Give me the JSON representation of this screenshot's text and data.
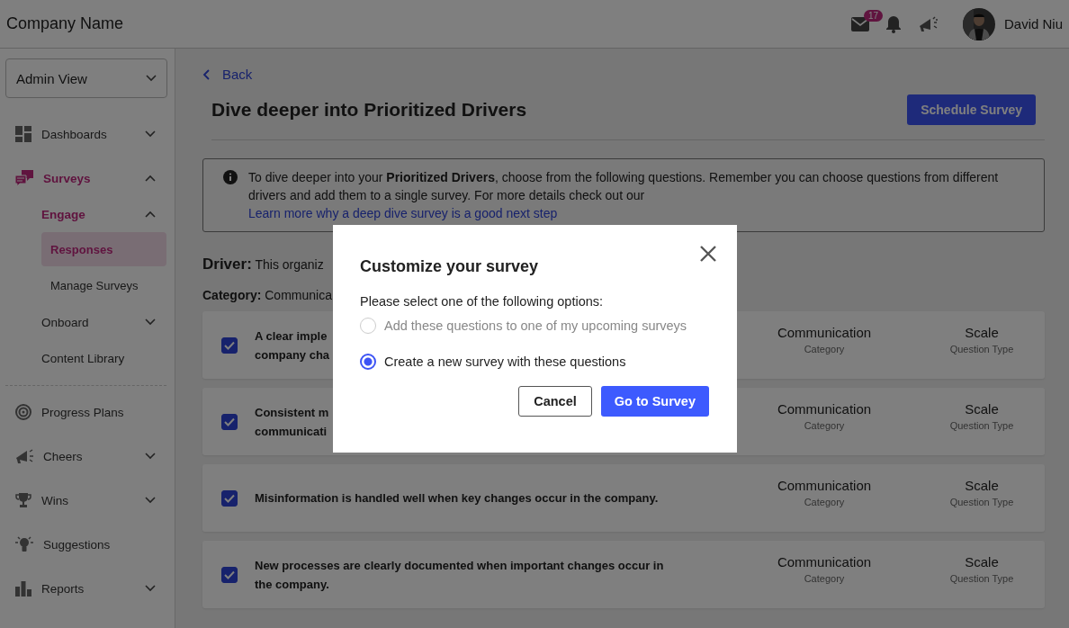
{
  "header": {
    "company": "Company Name",
    "mail_badge": "17",
    "user_name": "David Niu"
  },
  "sidebar": {
    "view_select": "Admin View",
    "groups": [
      [
        {
          "label": "Dashboards",
          "kind": "dashboards",
          "active": false,
          "expanded": false
        },
        {
          "label": "Surveys",
          "kind": "surveys",
          "active": true,
          "expanded": true,
          "children": [
            {
              "label": "Engage",
              "active": true,
              "expanded": true,
              "children": [
                {
                  "label": "Responses",
                  "selected": true
                },
                {
                  "label": "Manage Surveys",
                  "selected": false
                }
              ]
            },
            {
              "label": "Onboard",
              "active": false,
              "expanded": false
            },
            {
              "label": "Content Library",
              "active": false
            }
          ]
        }
      ],
      [
        {
          "label": "Progress Plans",
          "kind": "target",
          "active": false
        },
        {
          "label": "Cheers",
          "kind": "megaphone",
          "active": false,
          "expanded": false
        },
        {
          "label": "Wins",
          "kind": "trophy",
          "active": false,
          "expanded": false
        },
        {
          "label": "Suggestions",
          "kind": "bulb",
          "active": false
        },
        {
          "label": "Reports",
          "kind": "bars",
          "active": false,
          "expanded": false
        }
      ]
    ]
  },
  "main": {
    "back": "Back",
    "title": "Dive deeper into Prioritized Drivers",
    "schedule_button": "Schedule Survey",
    "info": {
      "text": "To dive deeper into your **Prioritized Drivers**, choose from the following questions. Remember you can choose questions from different drivers and add them to a single survey. For more details check out our",
      "link": "Learn more why a deep dive survey is a good next step"
    },
    "driver": {
      "label": "Driver:",
      "value": "This organiz"
    },
    "category": {
      "label": "Category:",
      "value": "Communica"
    },
    "questions": [
      {
        "lines": [
          "A clear imple",
          "company cha"
        ],
        "checked": true,
        "category": "Communication",
        "category_label": "Category",
        "type": "Scale",
        "type_label": "Question Type"
      },
      {
        "lines": [
          "Consistent m",
          "communicati"
        ],
        "checked": true,
        "category": "Communication",
        "category_label": "Category",
        "type": "Scale",
        "type_label": "Question Type"
      },
      {
        "lines": [
          "Misinformation is handled well when key changes occur in the company."
        ],
        "checked": true,
        "category": "Communication",
        "category_label": "Category",
        "type": "Scale",
        "type_label": "Question Type"
      },
      {
        "lines": [
          "New processes are clearly documented when important changes occur in",
          "the company."
        ],
        "checked": true,
        "category": "Communication",
        "category_label": "Category",
        "type": "Scale",
        "type_label": "Question Type"
      }
    ]
  },
  "modal": {
    "title": "Customize your survey",
    "prompt": "Please select one of the following options:",
    "options": [
      {
        "label": "Add these questions to one of my upcoming surveys",
        "selected": false,
        "disabled": true
      },
      {
        "label": "Create a new survey with these questions",
        "selected": true,
        "disabled": false
      }
    ],
    "cancel": "Cancel",
    "confirm": "Go to Survey"
  }
}
